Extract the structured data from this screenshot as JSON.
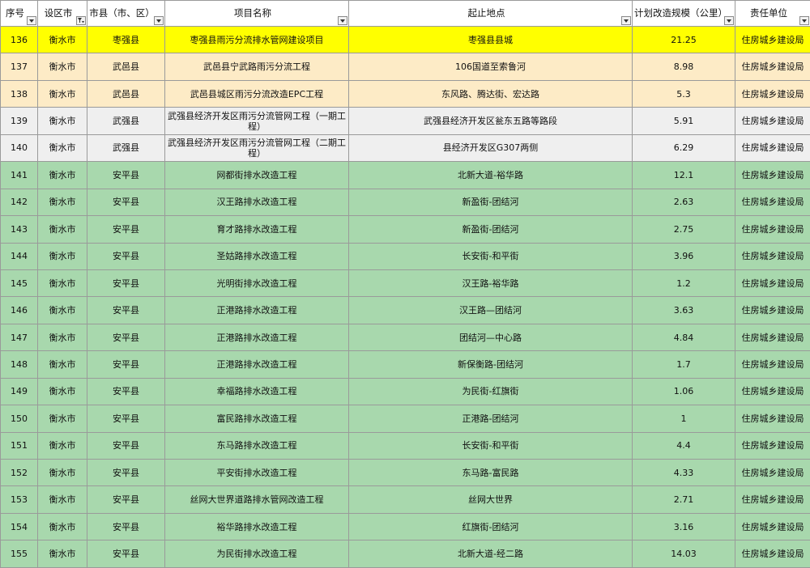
{
  "headers": [
    {
      "label": "序号",
      "filter": "dropdown"
    },
    {
      "label": "设区市",
      "filter": "filtered"
    },
    {
      "label": "市县（市、区）",
      "filter": "dropdown"
    },
    {
      "label": "项目名称",
      "filter": "dropdown"
    },
    {
      "label": "起止地点",
      "filter": "dropdown"
    },
    {
      "label": "计划改造规模（公里）",
      "filter": "dropdown"
    },
    {
      "label": "责任单位",
      "filter": "dropdown"
    }
  ],
  "row_colors": {
    "yellow": "#ffff00",
    "cream": "#fdebc6",
    "grey": "#efefef",
    "green": "#a8d8ad"
  },
  "rows": [
    {
      "style": "yellow",
      "cells": [
        "136",
        "衡水市",
        "枣强县",
        "枣强县雨污分流排水管网建设项目",
        "枣强县县城",
        "21.25",
        "住房城乡建设局"
      ]
    },
    {
      "style": "cream",
      "cells": [
        "137",
        "衡水市",
        "武邑县",
        "武邑县宁武路雨污分流工程",
        "106国道至索鲁河",
        "8.98",
        "住房城乡建设局"
      ]
    },
    {
      "style": "cream",
      "cells": [
        "138",
        "衡水市",
        "武邑县",
        "武邑县城区雨污分流改造EPC工程",
        "东风路、腾达街、宏达路",
        "5.3",
        "住房城乡建设局"
      ]
    },
    {
      "style": "grey",
      "cells": [
        "139",
        "衡水市",
        "武强县",
        "武强县经济开发区雨污分流管网工程（一期工程）",
        "武强县经济开发区瓮东五路等路段",
        "5.91",
        "住房城乡建设局"
      ]
    },
    {
      "style": "grey",
      "cells": [
        "140",
        "衡水市",
        "武强县",
        "武强县经济开发区雨污分流管网工程（二期工程）",
        "县经济开发区G307两侧",
        "6.29",
        "住房城乡建设局"
      ]
    },
    {
      "style": "green",
      "cells": [
        "141",
        "衡水市",
        "安平县",
        "网都街排水改造工程",
        "北新大道-裕华路",
        "12.1",
        "住房城乡建设局"
      ]
    },
    {
      "style": "green",
      "cells": [
        "142",
        "衡水市",
        "安平县",
        "汉王路排水改造工程",
        "新盈街-团结河",
        "2.63",
        "住房城乡建设局"
      ]
    },
    {
      "style": "green",
      "cells": [
        "143",
        "衡水市",
        "安平县",
        "育才路排水改造工程",
        "新盈街-团结河",
        "2.75",
        "住房城乡建设局"
      ]
    },
    {
      "style": "green",
      "cells": [
        "144",
        "衡水市",
        "安平县",
        "圣姑路排水改造工程",
        "长安街-和平街",
        "3.96",
        "住房城乡建设局"
      ]
    },
    {
      "style": "green",
      "cells": [
        "145",
        "衡水市",
        "安平县",
        "光明街排水改造工程",
        "汉王路-裕华路",
        "1.2",
        "住房城乡建设局"
      ]
    },
    {
      "style": "green",
      "cells": [
        "146",
        "衡水市",
        "安平县",
        "正港路排水改造工程",
        "汉王路—团结河",
        "3.63",
        "住房城乡建设局"
      ]
    },
    {
      "style": "green",
      "cells": [
        "147",
        "衡水市",
        "安平县",
        "正港路排水改造工程",
        "团结河—中心路",
        "4.84",
        "住房城乡建设局"
      ]
    },
    {
      "style": "green",
      "cells": [
        "148",
        "衡水市",
        "安平县",
        "正港路排水改造工程",
        "新保衡路-团结河",
        "1.7",
        "住房城乡建设局"
      ]
    },
    {
      "style": "green",
      "cells": [
        "149",
        "衡水市",
        "安平县",
        "幸福路排水改造工程",
        "为民街-红旗街",
        "1.06",
        "住房城乡建设局"
      ]
    },
    {
      "style": "green",
      "cells": [
        "150",
        "衡水市",
        "安平县",
        "富民路排水改造工程",
        "正港路-团结河",
        "1",
        "住房城乡建设局"
      ]
    },
    {
      "style": "green",
      "cells": [
        "151",
        "衡水市",
        "安平县",
        "东马路排水改造工程",
        "长安街-和平街",
        "4.4",
        "住房城乡建设局"
      ]
    },
    {
      "style": "green",
      "cells": [
        "152",
        "衡水市",
        "安平县",
        "平安街排水改造工程",
        "东马路-富民路",
        "4.33",
        "住房城乡建设局"
      ]
    },
    {
      "style": "green",
      "cells": [
        "153",
        "衡水市",
        "安平县",
        "丝网大世界道路排水管网改造工程",
        "丝网大世界",
        "2.71",
        "住房城乡建设局"
      ]
    },
    {
      "style": "green",
      "cells": [
        "154",
        "衡水市",
        "安平县",
        "裕华路排水改造工程",
        "红旗街-团结河",
        "3.16",
        "住房城乡建设局"
      ]
    },
    {
      "style": "green",
      "cells": [
        "155",
        "衡水市",
        "安平县",
        "为民街排水改造工程",
        "北新大道-经二路",
        "14.03",
        "住房城乡建设局"
      ]
    }
  ]
}
